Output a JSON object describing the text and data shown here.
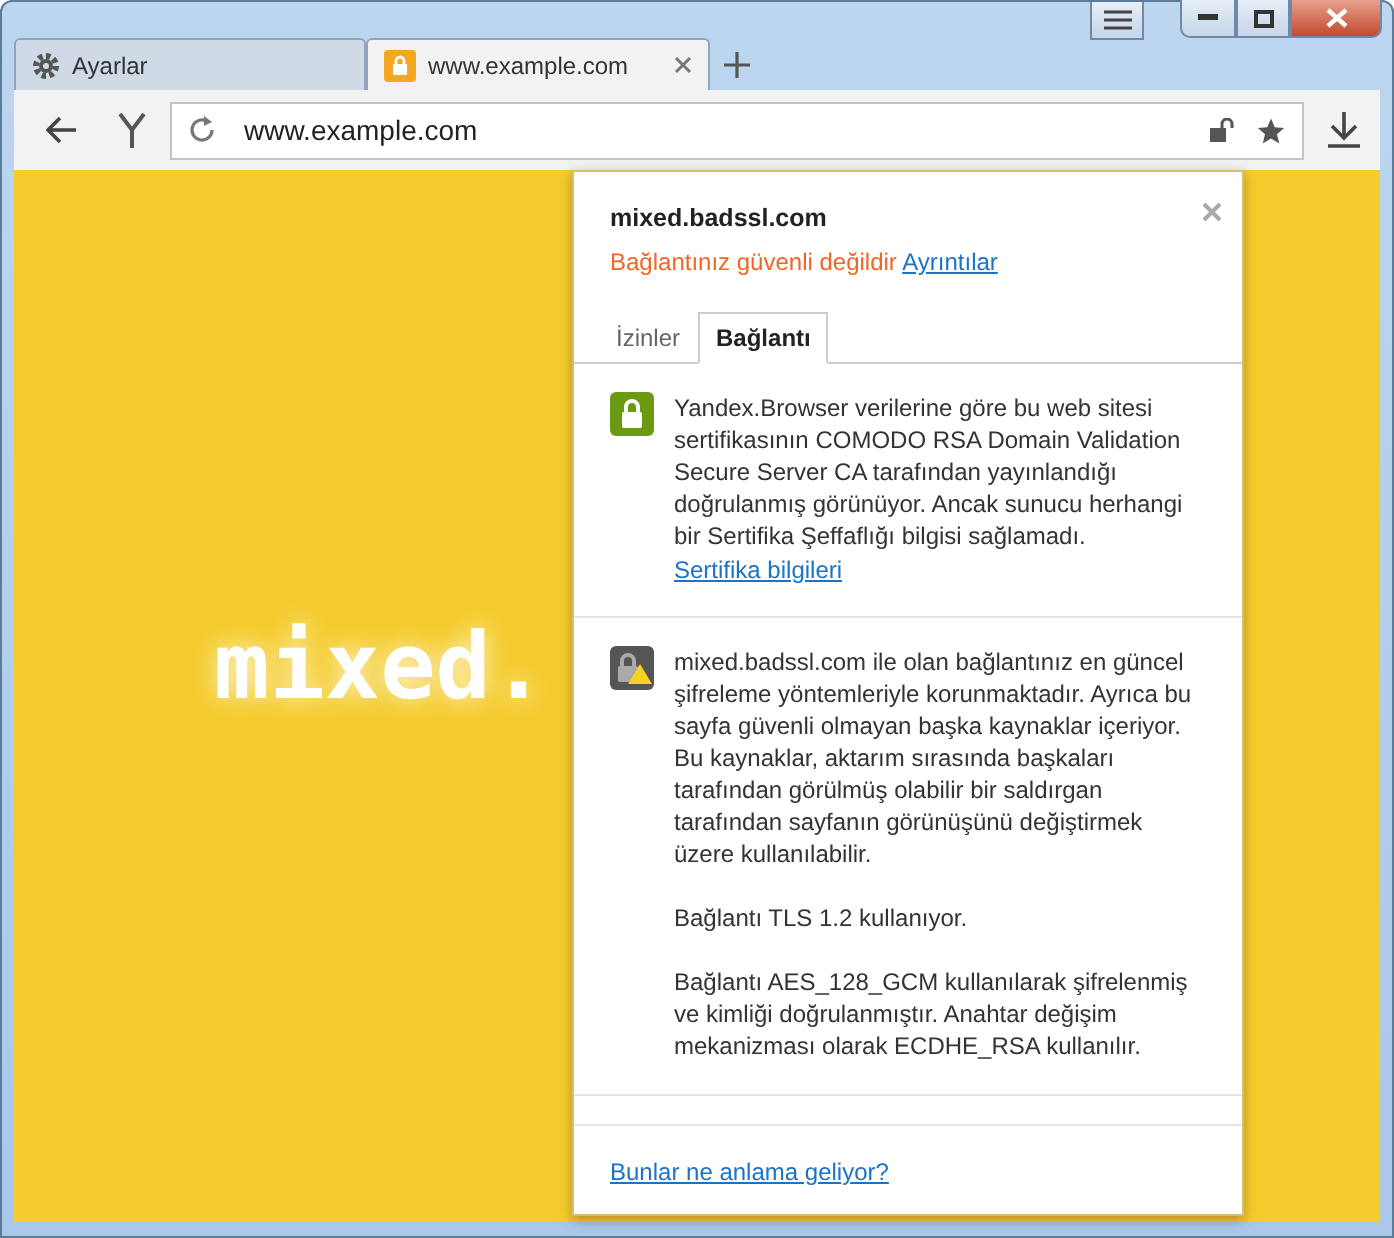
{
  "tabs": [
    {
      "label": "Ayarlar",
      "kind": "gear",
      "selected": false
    },
    {
      "label": "www.example.com",
      "kind": "lock",
      "selected": true
    }
  ],
  "address_bar": {
    "value": "www.example.com"
  },
  "page": {
    "heading": "mixed."
  },
  "popup": {
    "site": "mixed.badssl.com",
    "warning": "Bağlantınız güvenli değildir",
    "details_link": "Ayrıntılar",
    "tabs": [
      {
        "label": "İzinler",
        "selected": false
      },
      {
        "label": "Bağlantı",
        "selected": true
      }
    ],
    "sections": [
      {
        "kind": "secure",
        "paragraphs": [
          "Yandex.Browser verilerine göre bu web sitesi sertifikasının COMODO RSA Domain Validation Secure Server CA tarafından yayınlandığı doğrulanmış görünüyor. Ancak sunucu herhangi bir Sertifika Şeffaflığı bilgisi sağlamadı."
        ],
        "link": "Sertifika bilgileri"
      },
      {
        "kind": "mixed",
        "paragraphs": [
          "mixed.badssl.com ile olan bağlantınız en güncel şifreleme yöntemleriyle korunmaktadır. Ayrıca bu sayfa güvenli olmayan başka kaynaklar içeriyor. Bu kaynaklar, aktarım sırasında başkaları tarafından görülmüş olabilir bir saldırgan tarafından sayfanın görünüşünü değiştirmek üzere kullanılabilir.",
          "Bağlantı TLS 1.2 kullanıyor.",
          "Bağlantı AES_128_GCM kullanılarak şifrelenmiş ve kimliği doğrulanmıştır. Anahtar değişim mekanizması olarak ECDHE_RSA kullanılır."
        ]
      }
    ],
    "footer_link": "Bunlar ne anlama geliyor?"
  }
}
